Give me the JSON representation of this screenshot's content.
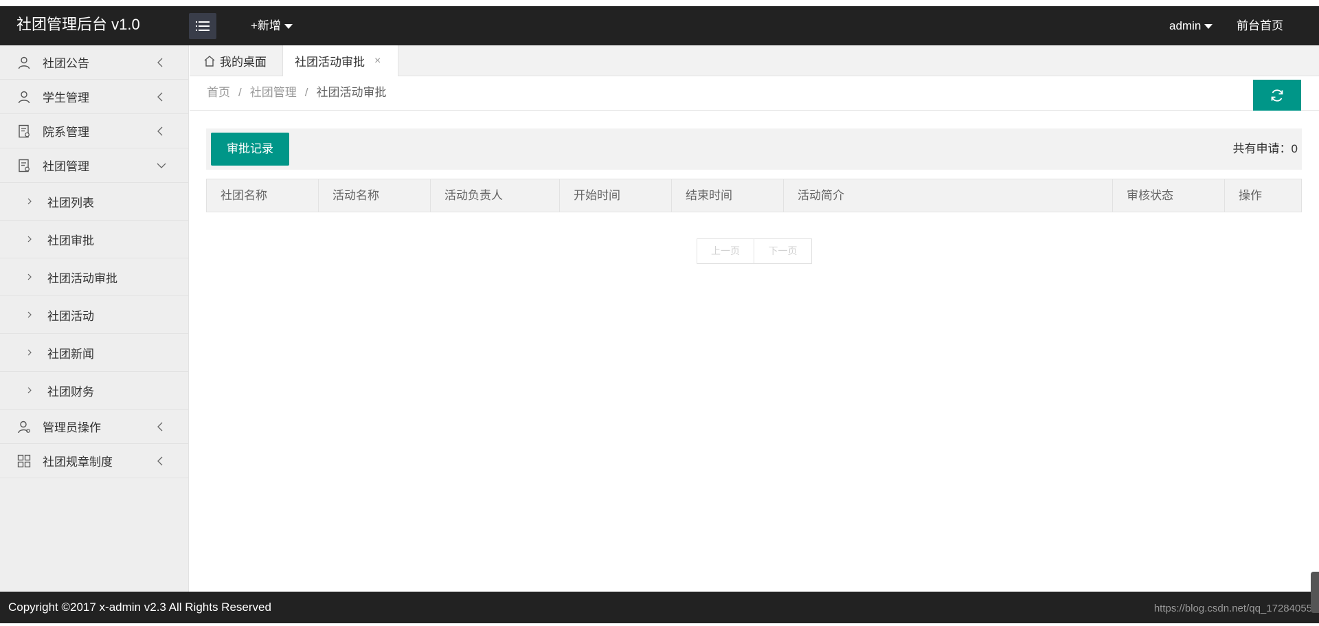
{
  "header": {
    "logo": "社团管理后台 v1.0",
    "add_new": "+新增",
    "user": "admin",
    "front_home": "前台首页"
  },
  "sidebar": {
    "items": [
      {
        "label": "社团公告",
        "icon": "user-icon",
        "expanded": false
      },
      {
        "label": "学生管理",
        "icon": "user-icon",
        "expanded": false
      },
      {
        "label": "院系管理",
        "icon": "document-icon",
        "expanded": false
      },
      {
        "label": "社团管理",
        "icon": "document-icon",
        "expanded": true
      },
      {
        "label": "管理员操作",
        "icon": "admin-icon",
        "expanded": false
      },
      {
        "label": "社团规章制度",
        "icon": "grid-icon",
        "expanded": false
      }
    ],
    "sub_items": [
      "社团列表",
      "社团审批",
      "社团活动审批",
      "社团活动",
      "社团新闻",
      "社团财务"
    ]
  },
  "tabs": {
    "home": "我的桌面",
    "active": "社团活动审批",
    "close": "×"
  },
  "breadcrumb": {
    "items": [
      "首页",
      "社团管理",
      "社团活动审批"
    ],
    "separator": "/"
  },
  "toolbar": {
    "records_button": "审批记录",
    "total_label": "共有申请：",
    "total_count": "0"
  },
  "table": {
    "columns": [
      "社团名称",
      "活动名称",
      "活动负责人",
      "开始时间",
      "结束时间",
      "活动简介",
      "审核状态",
      "操作"
    ]
  },
  "pager": {
    "prev": "上一页",
    "next": "下一页"
  },
  "footer": {
    "copyright": "Copyright ©2017 x-admin v2.3 All Rights Reserved",
    "url": "https://blog.csdn.net/qq_17284055"
  },
  "colors": {
    "accent": "#009688",
    "header_bg": "#222222",
    "sidebar_bg": "#eeeeee"
  }
}
